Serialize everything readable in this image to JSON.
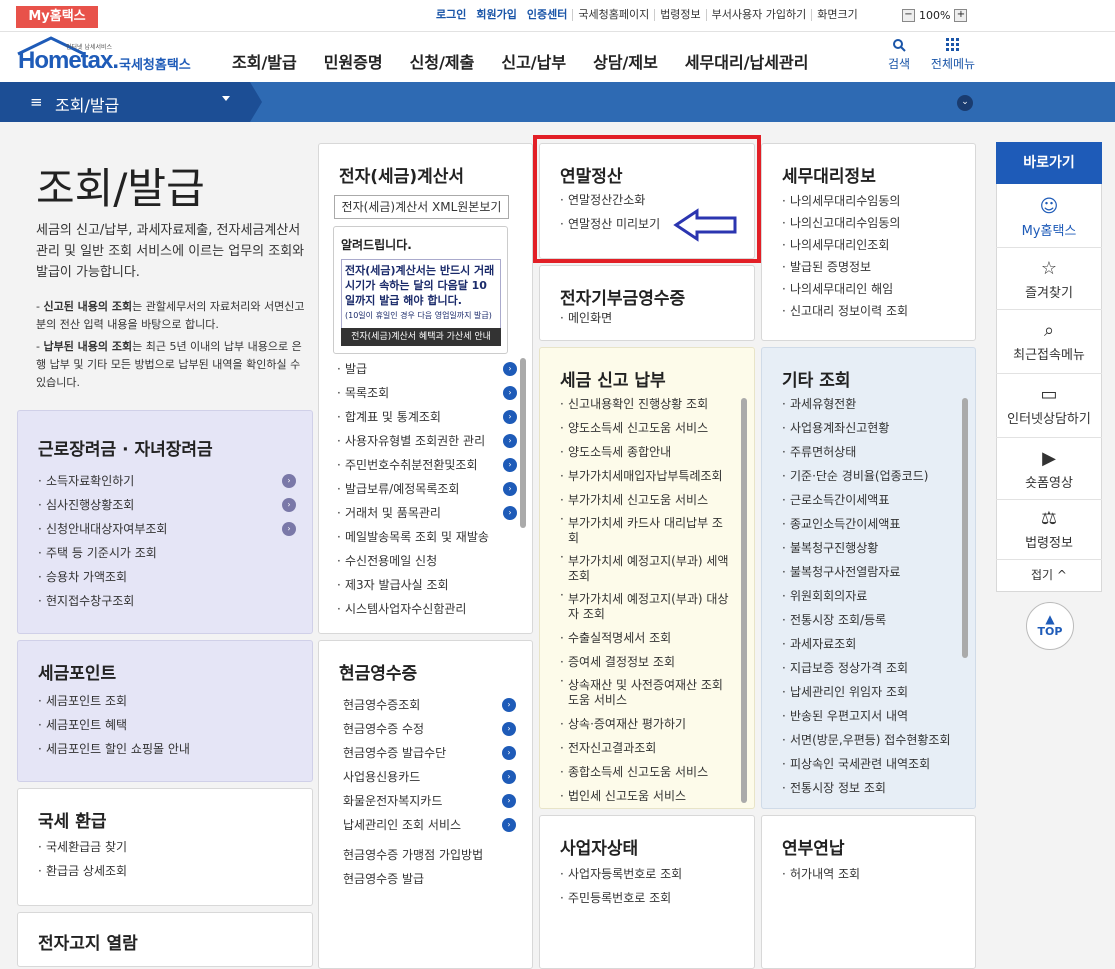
{
  "topbar": {
    "my_tab": "My홈택스",
    "links": [
      "로그인",
      "회원가입",
      "인증센터",
      "국세청홈페이지",
      "법령정보",
      "부서사용자 가입하기",
      "화면크기"
    ],
    "zoom": "100%"
  },
  "header": {
    "logo": "Hometax.",
    "logo_sub": "국세청홈택스",
    "logo_tiny": "인터넷 납세서비스",
    "gnb": [
      "조회/발급",
      "민원증명",
      "신청/제출",
      "신고/납부",
      "상담/제보",
      "세무대리/납세관리"
    ],
    "search": "검색",
    "allmenu": "전체메뉴"
  },
  "location": {
    "title": "조회/발급"
  },
  "intro": {
    "title": "조회/발급",
    "desc": "세금의 신고/납부, 과세자료제출, 전자세금계산서 관리 및 일반 조회 서비스에 이르는 업무의 조회와 발급이 가능합니다.",
    "note1_b": "신고된 내용의 조회",
    "note1": "는 관할세무서의 자료처리와 서면신고분의 전산 입력 내용을 바탕으로 합니다.",
    "note2_b": "납부된 내용의 조회",
    "note2": "는 최근 5년 이내의 납부 내용으로 은행 납부 및 기타 모든 방법으로 납부된 내역을 확인하실 수 있습니다."
  },
  "einvoice": {
    "title": "전자(세금)계산서",
    "xml_btn": "전자(세금)계산서 XML원본보기",
    "notice_title": "알려드립니다.",
    "notice_body": "전자(세금)계산서는 반드시 거래시기가 속하는 달의 다음달 10일까지 발급 해야 합니다.",
    "notice_small": "(10일이 휴일인 경우 다음 영업일까지 발급)",
    "notice_btn": "전자(세금)계산서 혜택과 가산세 안내",
    "items": [
      "발급",
      "목록조회",
      "합계표 및 통계조회",
      "사용자유형별 조회권한 관리",
      "주민번호수취분전환및조회",
      "발급보류/예정목록조회",
      "거래처 및 품목관리",
      "메일발송목록 조회 및 재발송",
      "수신전용메일 신청",
      "제3자 발급사실 조회",
      "시스템사업자수신함관리"
    ]
  },
  "yearend": {
    "title": "연말정산",
    "items": [
      "연말정산간소화",
      "연말정산 미리보기"
    ]
  },
  "donation": {
    "title": "전자기부금영수증",
    "items": [
      "메인화면"
    ]
  },
  "agent": {
    "title": "세무대리정보",
    "items": [
      "나의세무대리수임동의",
      "나의신고대리수임동의",
      "나의세무대리인조회",
      "발급된 증명정보",
      "나의세무대리인 해임",
      "신고대리 정보이력 조회"
    ]
  },
  "worker": {
    "title": "근로장려금 · 자녀장려금",
    "items": [
      "소득자료확인하기",
      "심사진행상황조회",
      "신청안내대상자여부조회",
      "주택 등 기준시가 조회",
      "승용차 가액조회",
      "현지접수창구조회"
    ]
  },
  "point": {
    "title": "세금포인트",
    "items": [
      "세금포인트 조회",
      "세금포인트 혜택",
      "세금포인트 할인 쇼핑몰 안내"
    ]
  },
  "refund": {
    "title": "국세 환급",
    "items": [
      "국세환급금 찾기",
      "환급금 상세조회"
    ]
  },
  "notice_view": {
    "title": "전자고지 열람"
  },
  "tax": {
    "title": "세금 신고 납부",
    "items": [
      "신고내용확인 진행상황 조회",
      "양도소득세 신고도움 서비스",
      "양도소득세 종합안내",
      "부가가치세매입자납부특례조회",
      "부가가치세 신고도움 서비스",
      "부가가치세 카드사 대리납부 조회",
      "부가가치세 예정고지(부과) 세액조회",
      "부가가치세 예정고지(부과) 대상자 조회",
      "수출실적명세서 조회",
      "증여세 결정정보 조회",
      "상속재산 및 사전증여재산 조회 도움 서비스",
      "상속·증여재산 평가하기",
      "전자신고결과조회",
      "종합소득세 신고도움 서비스",
      "법인세 신고도움 서비스"
    ]
  },
  "etc": {
    "title": "기타 조회",
    "items": [
      "과세유형전환",
      "사업용계좌신고현황",
      "주류면허상태",
      "기준·단순 경비율(업종코드)",
      "근로소득간이세액표",
      "종교인소득간이세액표",
      "불복청구진행상황",
      "불복청구사전열람자료",
      "위원회회의자료",
      "전통시장 조회/등록",
      "과세자료조회",
      "지급보증 정상가격 조회",
      "납세관리인 위임자 조회",
      "반송된 우편고지서 내역",
      "서면(방문,우편등) 접수현황조회",
      "피상속인 국세관련 내역조회",
      "전통시장 정보 조회"
    ]
  },
  "cash": {
    "title": "현금영수증",
    "items": [
      "현금영수증조회",
      "현금영수증 수정",
      "현금영수증 발급수단",
      "사업용신용카드",
      "화물운전자복지카드",
      "납세관리인 조회 서비스"
    ],
    "items_plain": [
      "현금영수증 가맹점 가입방법",
      "현금영수증 발급"
    ]
  },
  "biz": {
    "title": "사업자상태",
    "items": [
      "사업자등록번호로 조회",
      "주민등록번호로 조회"
    ]
  },
  "pension": {
    "title": "연부연납",
    "items": [
      "허가내역 조회"
    ]
  },
  "quick": {
    "head": "바로가기",
    "items": [
      "My홈택스",
      "즐겨찾기",
      "최근접속메뉴",
      "인터넷상담하기",
      "숏폼영상",
      "법령정보"
    ],
    "fold": "접기 ^",
    "top": "TOP"
  }
}
